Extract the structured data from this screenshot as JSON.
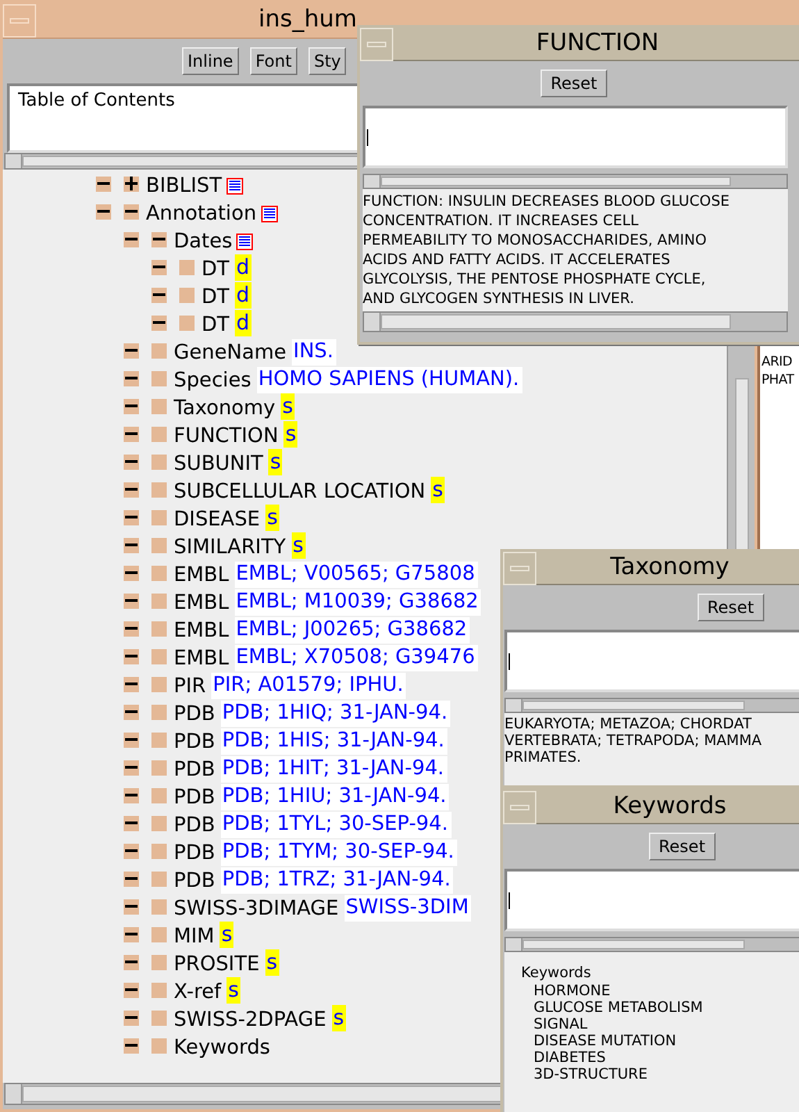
{
  "main_window": {
    "title": "ins_hum",
    "toolbar": [
      "Inline",
      "Font",
      "Sty"
    ],
    "toc": {
      "value": "Table of Contents"
    },
    "tree": [
      {
        "label": "BIBLIST",
        "expanded": false,
        "badge": {
          "kind": "list"
        }
      },
      {
        "label": "Annotation",
        "expanded": true,
        "badge": {
          "kind": "list"
        },
        "children": [
          {
            "label": "Dates",
            "expanded": true,
            "badge": {
              "kind": "list"
            },
            "children": [
              {
                "label": "DT",
                "badge": {
                  "kind": "chip",
                  "text": "d"
                }
              },
              {
                "label": "DT",
                "badge": {
                  "kind": "chip",
                  "text": "d"
                }
              },
              {
                "label": "DT",
                "badge": {
                  "kind": "chip",
                  "text": "d"
                }
              }
            ]
          },
          {
            "label": "GeneName",
            "badge": {
              "kind": "value",
              "text": "INS."
            }
          },
          {
            "label": "Species",
            "badge": {
              "kind": "value",
              "text": "HOMO SAPIENS (HUMAN)."
            }
          },
          {
            "label": "Taxonomy",
            "badge": {
              "kind": "chip",
              "text": "s"
            }
          },
          {
            "label": "FUNCTION",
            "badge": {
              "kind": "chip",
              "text": "s"
            }
          },
          {
            "label": "SUBUNIT",
            "badge": {
              "kind": "chip",
              "text": "s"
            }
          },
          {
            "label": "SUBCELLULAR LOCATION",
            "badge": {
              "kind": "chip",
              "text": "s"
            }
          },
          {
            "label": "DISEASE",
            "badge": {
              "kind": "chip",
              "text": "s"
            }
          },
          {
            "label": "SIMILARITY",
            "badge": {
              "kind": "chip",
              "text": "s"
            }
          },
          {
            "label": "EMBL",
            "badge": {
              "kind": "value",
              "text": "EMBL; V00565; G75808"
            }
          },
          {
            "label": "EMBL",
            "badge": {
              "kind": "value",
              "text": "EMBL; M10039; G38682"
            }
          },
          {
            "label": "EMBL",
            "badge": {
              "kind": "value",
              "text": "EMBL; J00265; G38682"
            }
          },
          {
            "label": "EMBL",
            "badge": {
              "kind": "value",
              "text": "EMBL; X70508; G39476"
            }
          },
          {
            "label": "PIR",
            "badge": {
              "kind": "value",
              "text": "PIR; A01579; IPHU."
            }
          },
          {
            "label": "PDB",
            "badge": {
              "kind": "value",
              "text": "PDB; 1HIQ; 31-JAN-94."
            }
          },
          {
            "label": "PDB",
            "badge": {
              "kind": "value",
              "text": "PDB; 1HIS; 31-JAN-94."
            }
          },
          {
            "label": "PDB",
            "badge": {
              "kind": "value",
              "text": "PDB; 1HIT; 31-JAN-94."
            }
          },
          {
            "label": "PDB",
            "badge": {
              "kind": "value",
              "text": "PDB; 1HIU; 31-JAN-94."
            }
          },
          {
            "label": "PDB",
            "badge": {
              "kind": "value",
              "text": "PDB; 1TYL; 30-SEP-94."
            }
          },
          {
            "label": "PDB",
            "badge": {
              "kind": "value",
              "text": "PDB; 1TYM; 30-SEP-94."
            }
          },
          {
            "label": "PDB",
            "badge": {
              "kind": "value",
              "text": "PDB; 1TRZ; 31-JAN-94."
            }
          },
          {
            "label": "SWISS-3DIMAGE",
            "badge": {
              "kind": "value",
              "text": "SWISS-3DIM"
            }
          },
          {
            "label": "MIM",
            "badge": {
              "kind": "chip",
              "text": "s"
            }
          },
          {
            "label": "PROSITE",
            "badge": {
              "kind": "chip",
              "text": "s"
            }
          },
          {
            "label": "X-ref",
            "badge": {
              "kind": "chip",
              "text": "s"
            }
          },
          {
            "label": "SWISS-2DPAGE",
            "badge": {
              "kind": "chip",
              "text": "s"
            }
          },
          {
            "label": "Keywords"
          }
        ]
      }
    ]
  },
  "behind_window": {
    "lines": [
      "ARID",
      "PHAT"
    ]
  },
  "function_window": {
    "title": "FUNCTION",
    "button": "Reset",
    "lines": [
      "FUNCTION: INSULIN DECREASES BLOOD GLUCOSE",
      "CONCENTRATION. IT INCREASES CELL",
      "PERMEABILITY TO MONOSACCHARIDES, AMINO",
      "ACIDS AND FATTY ACIDS. IT ACCELERATES",
      "GLYCOLYSIS, THE PENTOSE PHOSPHATE CYCLE,",
      "AND GLYCOGEN SYNTHESIS IN LIVER."
    ]
  },
  "taxonomy_window": {
    "title": "Taxonomy",
    "button": "Reset",
    "lines": [
      "EUKARYOTA; METAZOA; CHORDAT",
      "VERTEBRATA; TETRAPODA; MAMMA",
      "PRIMATES."
    ]
  },
  "keywords_window": {
    "title": "Keywords",
    "button": "Reset",
    "heading": "Keywords",
    "items": [
      "HORMONE",
      "GLUCOSE METABOLISM",
      "SIGNAL",
      "DISEASE MUTATION",
      "DIABETES",
      "3D-STRUCTURE"
    ]
  }
}
